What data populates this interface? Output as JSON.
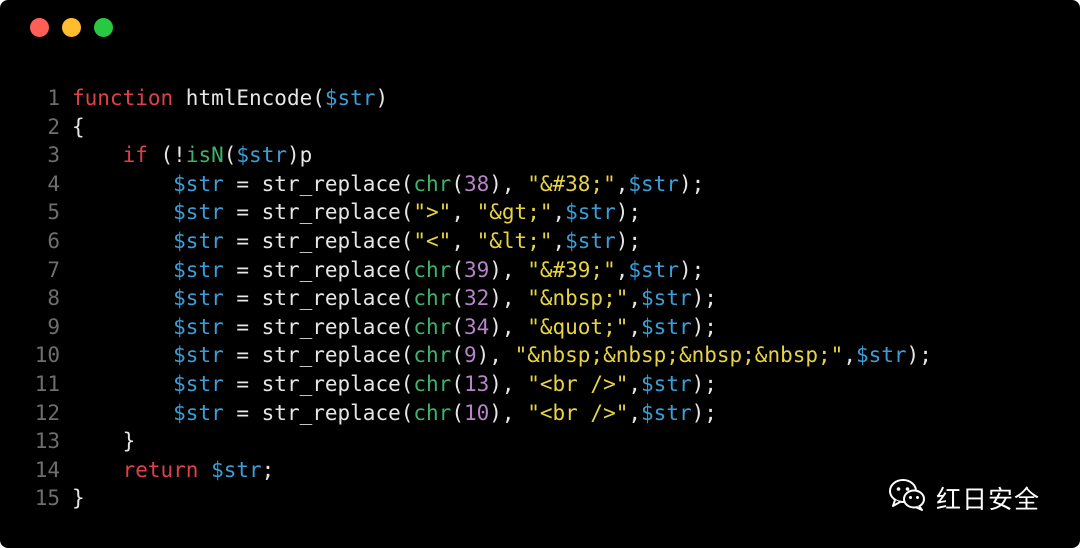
{
  "window": {
    "controls": [
      {
        "name": "close",
        "color": "#ff5f57"
      },
      {
        "name": "minimize",
        "color": "#febc2e"
      },
      {
        "name": "maximize",
        "color": "#28c840"
      }
    ]
  },
  "colors": {
    "keyword": "#e0404a",
    "plain": "#e6e6e6",
    "variable": "#3a9fd8",
    "string": "#e8d442",
    "builtin": "#3db36a",
    "number": "#b784c9",
    "line_number": "#6e6e6e"
  },
  "code": {
    "lines": [
      {
        "num": "1",
        "tokens": [
          [
            "function",
            "keyword"
          ],
          [
            " htmlEncode(",
            "plain"
          ],
          [
            "$str",
            "variable"
          ],
          [
            ")",
            "plain"
          ]
        ]
      },
      {
        "num": "2",
        "tokens": [
          [
            "{",
            "plain"
          ]
        ]
      },
      {
        "num": "3",
        "tokens": [
          [
            "    ",
            "plain"
          ],
          [
            "if",
            "keyword"
          ],
          [
            " (!",
            "plain"
          ],
          [
            "isN",
            "builtin"
          ],
          [
            "(",
            "plain"
          ],
          [
            "$str",
            "variable"
          ],
          ")){",
          "plain"
        ]
      },
      {
        "num": "4",
        "tokens": [
          [
            "        ",
            "plain"
          ],
          [
            "$str",
            "variable"
          ],
          [
            " = str_replace(",
            "plain"
          ],
          [
            "chr",
            "builtin"
          ],
          [
            "(",
            "plain"
          ],
          [
            "38",
            "number"
          ],
          [
            "), ",
            "plain"
          ],
          [
            "\"&#38;\"",
            "string"
          ],
          [
            ",",
            "plain"
          ],
          [
            "$str",
            "variable"
          ],
          [
            ");",
            "plain"
          ]
        ]
      },
      {
        "num": "5",
        "tokens": [
          [
            "        ",
            "plain"
          ],
          [
            "$str",
            "variable"
          ],
          [
            " = str_replace(",
            "plain"
          ],
          [
            "\">\"",
            "string"
          ],
          [
            ", ",
            "plain"
          ],
          [
            "\"&gt;\"",
            "string"
          ],
          [
            ",",
            "plain"
          ],
          [
            "$str",
            "variable"
          ],
          [
            ");",
            "plain"
          ]
        ]
      },
      {
        "num": "6",
        "tokens": [
          [
            "        ",
            "plain"
          ],
          [
            "$str",
            "variable"
          ],
          [
            " = str_replace(",
            "plain"
          ],
          [
            "\"<\"",
            "string"
          ],
          [
            ", ",
            "plain"
          ],
          [
            "\"&lt;\"",
            "string"
          ],
          [
            ",",
            "plain"
          ],
          [
            "$str",
            "variable"
          ],
          [
            ");",
            "plain"
          ]
        ]
      },
      {
        "num": "7",
        "tokens": [
          [
            "        ",
            "plain"
          ],
          [
            "$str",
            "variable"
          ],
          [
            " = str_replace(",
            "plain"
          ],
          [
            "chr",
            "builtin"
          ],
          [
            "(",
            "plain"
          ],
          [
            "39",
            "number"
          ],
          [
            "), ",
            "plain"
          ],
          [
            "\"&#39;\"",
            "string"
          ],
          [
            ",",
            "plain"
          ],
          [
            "$str",
            "variable"
          ],
          [
            ");",
            "plain"
          ]
        ]
      },
      {
        "num": "8",
        "tokens": [
          [
            "        ",
            "plain"
          ],
          [
            "$str",
            "variable"
          ],
          [
            " = str_replace(",
            "plain"
          ],
          [
            "chr",
            "builtin"
          ],
          [
            "(",
            "plain"
          ],
          [
            "32",
            "number"
          ],
          [
            "), ",
            "plain"
          ],
          [
            "\"&nbsp;\"",
            "string"
          ],
          [
            ",",
            "plain"
          ],
          [
            "$str",
            "variable"
          ],
          [
            ");",
            "plain"
          ]
        ]
      },
      {
        "num": "9",
        "tokens": [
          [
            "        ",
            "plain"
          ],
          [
            "$str",
            "variable"
          ],
          [
            " = str_replace(",
            "plain"
          ],
          [
            "chr",
            "builtin"
          ],
          [
            "(",
            "plain"
          ],
          [
            "34",
            "number"
          ],
          [
            "), ",
            "plain"
          ],
          [
            "\"&quot;\"",
            "string"
          ],
          [
            ",",
            "plain"
          ],
          [
            "$str",
            "variable"
          ],
          [
            ");",
            "plain"
          ]
        ]
      },
      {
        "num": "10",
        "tokens": [
          [
            "        ",
            "plain"
          ],
          [
            "$str",
            "variable"
          ],
          [
            " = str_replace(",
            "plain"
          ],
          [
            "chr",
            "builtin"
          ],
          [
            "(",
            "plain"
          ],
          [
            "9",
            "number"
          ],
          [
            "), ",
            "plain"
          ],
          [
            "\"&nbsp;&nbsp;&nbsp;&nbsp;\"",
            "string"
          ],
          [
            ",",
            "plain"
          ],
          [
            "$str",
            "variable"
          ],
          [
            ");",
            "plain"
          ]
        ]
      },
      {
        "num": "11",
        "tokens": [
          [
            "        ",
            "plain"
          ],
          [
            "$str",
            "variable"
          ],
          [
            " = str_replace(",
            "plain"
          ],
          [
            "chr",
            "builtin"
          ],
          [
            "(",
            "plain"
          ],
          [
            "13",
            "number"
          ],
          [
            "), ",
            "plain"
          ],
          [
            "\"<br />\"",
            "string"
          ],
          [
            ",",
            "plain"
          ],
          [
            "$str",
            "variable"
          ],
          [
            ");",
            "plain"
          ]
        ]
      },
      {
        "num": "12",
        "tokens": [
          [
            "        ",
            "plain"
          ],
          [
            "$str",
            "variable"
          ],
          [
            " = str_replace(",
            "plain"
          ],
          [
            "chr",
            "builtin"
          ],
          [
            "(",
            "plain"
          ],
          [
            "10",
            "number"
          ],
          [
            "), ",
            "plain"
          ],
          [
            "\"<br />\"",
            "string"
          ],
          [
            ",",
            "plain"
          ],
          [
            "$str",
            "variable"
          ],
          [
            ");",
            "plain"
          ]
        ]
      },
      {
        "num": "13",
        "tokens": [
          [
            "    }",
            "plain"
          ]
        ]
      },
      {
        "num": "14",
        "tokens": [
          [
            "    ",
            "plain"
          ],
          [
            "return",
            "keyword"
          ],
          [
            " ",
            "plain"
          ],
          [
            "$str",
            "variable"
          ],
          [
            ";",
            "plain"
          ]
        ]
      },
      {
        "num": "15",
        "tokens": [
          [
            "}",
            "plain"
          ]
        ]
      }
    ]
  },
  "watermark": {
    "icon": "wechat-icon",
    "text": "红日安全"
  }
}
